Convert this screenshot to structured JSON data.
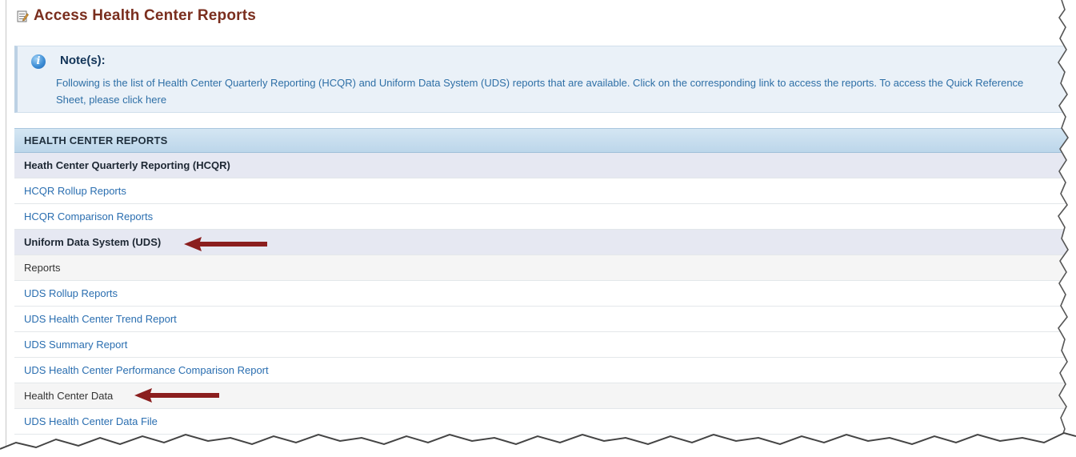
{
  "header": {
    "title": "Access Health Center Reports",
    "icon": "report-icon"
  },
  "note": {
    "icon": "info-icon",
    "heading": "Note(s):",
    "body_text": "Following is the list of Health Center Quarterly Reporting (HCQR) and Uniform Data System (UDS) reports that are available. Click on the corresponding link to access the reports. To access the Quick Reference Sheet, please",
    "link_text": "click here"
  },
  "reports": {
    "header": "HEALTH CENTER REPORTS",
    "hcqr_section": "Heath Center Quarterly Reporting (HCQR)",
    "hcqr_rollup": "HCQR Rollup Reports",
    "hcqr_comparison": "HCQR Comparison Reports",
    "uds_section": "Uniform Data System (UDS)",
    "uds_reports_label": "Reports",
    "uds_rollup": "UDS Rollup Reports",
    "uds_trend": "UDS Health Center Trend Report",
    "uds_summary": "UDS Summary Report",
    "uds_performance": "UDS Health Center Performance Comparison Report",
    "health_center_data_label": "Health Center Data",
    "uds_data_file": "UDS Health Center Data File"
  },
  "colors": {
    "title": "#7a2e1e",
    "link": "#2a6eb0",
    "arrow": "#8b1e1e",
    "header_bar": "#c5dcee",
    "section_bg": "#e6e8f2"
  }
}
